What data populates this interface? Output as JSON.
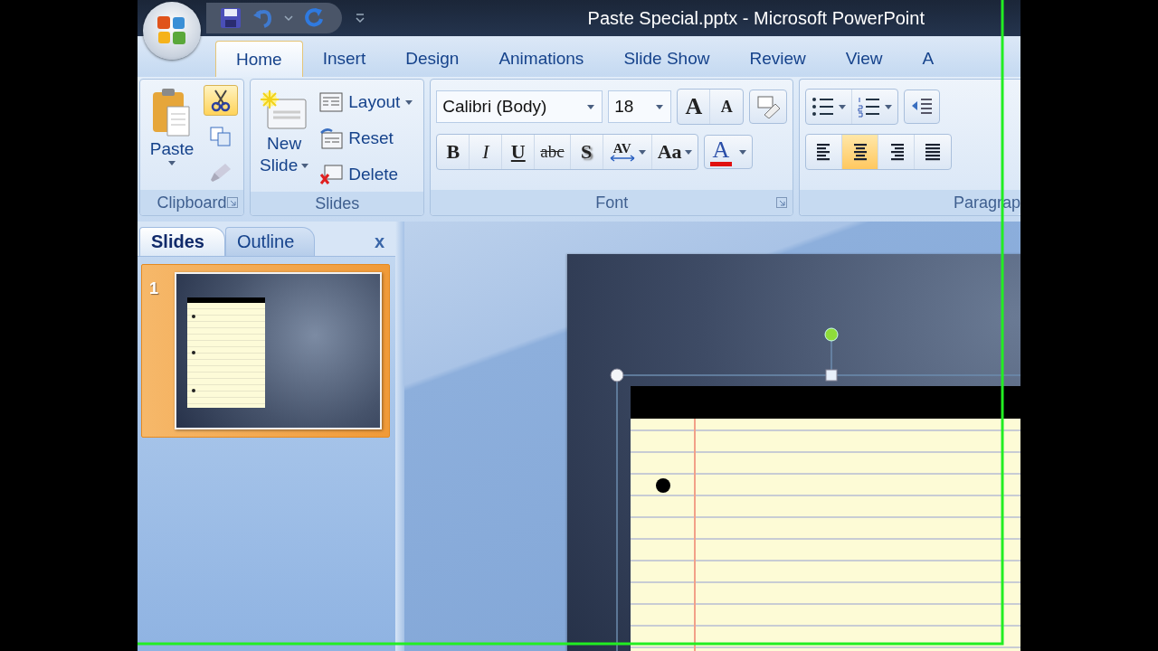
{
  "window": {
    "title": "Paste Special.pptx - Microsoft PowerPoint"
  },
  "tabs": [
    {
      "label": "Home",
      "selected": true
    },
    {
      "label": "Insert",
      "selected": false
    },
    {
      "label": "Design",
      "selected": false
    },
    {
      "label": "Animations",
      "selected": false
    },
    {
      "label": "Slide Show",
      "selected": false
    },
    {
      "label": "Review",
      "selected": false
    },
    {
      "label": "View",
      "selected": false
    },
    {
      "label": "A",
      "selected": false
    }
  ],
  "clipboard": {
    "title": "Clipboard",
    "paste": "Paste",
    "cut_hovered": true
  },
  "slides_group": {
    "title": "Slides",
    "new_slide": [
      "New",
      "Slide"
    ],
    "commands": [
      {
        "kind": "layout",
        "label": "Layout",
        "dropdown": true
      },
      {
        "kind": "reset",
        "label": "Reset",
        "dropdown": false
      },
      {
        "kind": "delete",
        "label": "Delete",
        "dropdown": false
      }
    ]
  },
  "font": {
    "title": "Font",
    "font_name": "Calibri (Body)",
    "font_size": "18",
    "grow": "A",
    "shrink": "A",
    "formats": [
      {
        "kind": "bold",
        "label": "B"
      },
      {
        "kind": "italic",
        "label": "I"
      },
      {
        "kind": "underline",
        "label": "U"
      },
      {
        "kind": "strike",
        "label": "abc"
      },
      {
        "kind": "shadow",
        "label": "S"
      },
      {
        "kind": "spacing",
        "label": "AV"
      },
      {
        "kind": "case",
        "label": "Aa"
      }
    ],
    "color_label": "A"
  },
  "paragraph": {
    "title": "Paragrap",
    "alignments": [
      {
        "kind": "left",
        "selected": false
      },
      {
        "kind": "center",
        "selected": true
      },
      {
        "kind": "right",
        "selected": false
      },
      {
        "kind": "justify",
        "selected": false
      }
    ]
  },
  "pane": {
    "tabs": [
      {
        "label": "Slides",
        "selected": true
      },
      {
        "label": "Outline",
        "selected": false
      }
    ],
    "close": "x",
    "thumbnails": [
      {
        "number": "1",
        "selected": true
      }
    ]
  }
}
